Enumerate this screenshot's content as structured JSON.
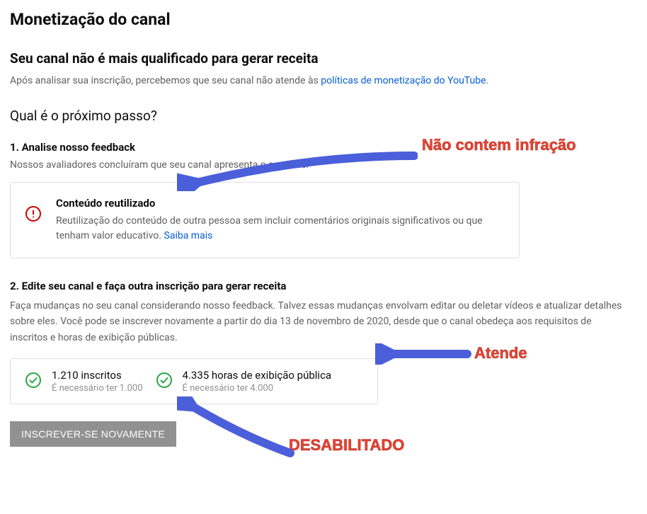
{
  "page": {
    "title": "Monetização do canal",
    "heading": "Seu canal não é mais qualificado para gerar receita",
    "descPrefix": "Após analisar sua inscrição, percebemos que seu canal não atende às ",
    "policyLink": "políticas de monetização do YouTube",
    "descSuffix": "."
  },
  "next": {
    "heading": "Qual é o próximo passo?"
  },
  "step1": {
    "title": "1. Analise nosso feedback",
    "desc": "Nossos avaliadores concluíram que seu canal apresenta o seguinte:"
  },
  "feedback": {
    "title": "Conteúdo reutilizado",
    "body": "Reutilização do conteúdo de outra pessoa sem incluir comentários originais significativos ou que tenham valor educativo. ",
    "learnMore": "Saiba mais"
  },
  "step2": {
    "title": "2. Edite seu canal e faça outra inscrição para gerar receita",
    "desc": "Faça mudanças no seu canal considerando nosso feedback. Talvez essas mudanças envolvam editar ou deletar vídeos e atualizar detalhes sobre eles. Você pode se inscrever novamente a partir do dia 13 de novembro de 2020, desde que o canal obedeça aos requisitos de inscritos e horas de exibição públicas."
  },
  "requirements": {
    "subs": {
      "value": "1.210 inscritos",
      "need": "É necessário ter 1.000"
    },
    "hours": {
      "value": "4.335 horas de exibição pública",
      "need": "É necessário ter 4.000"
    }
  },
  "button": {
    "reapply": "Inscrever-se novamente"
  },
  "annotations": {
    "a1": "Não contem infração",
    "a2": "Atende",
    "a3": "DESABILITADO"
  },
  "colors": {
    "link": "#065fd4",
    "error": "#cc0000",
    "success": "#2ba640",
    "disabledBtn": "#919191",
    "arrow": "#4a5fd9",
    "annotationText": "#ea4335"
  }
}
